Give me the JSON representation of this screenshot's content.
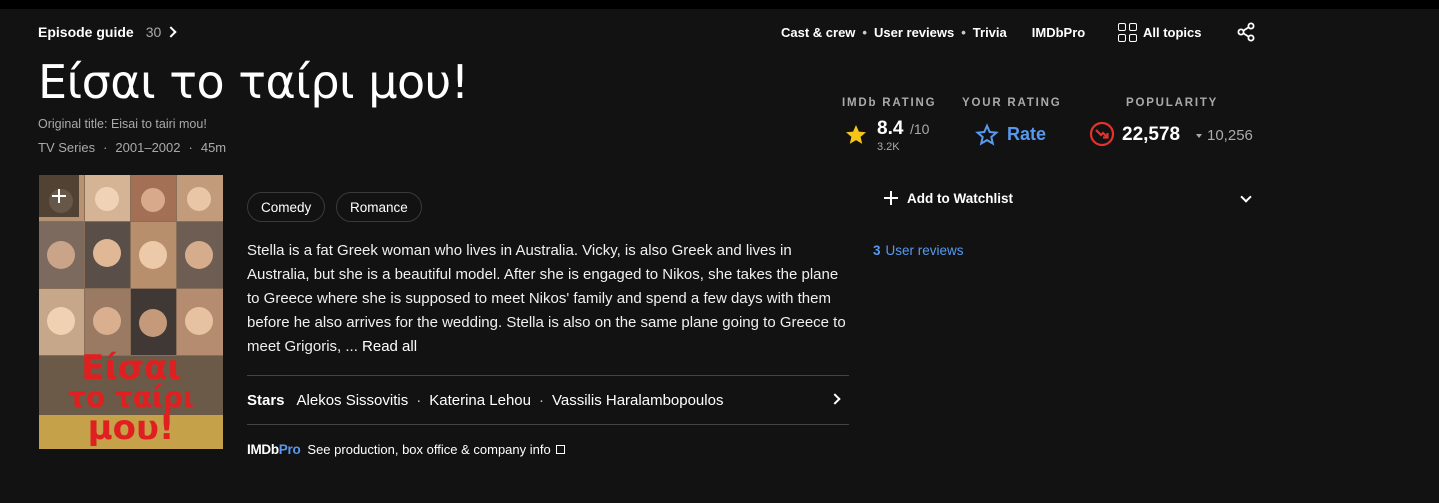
{
  "top": {
    "episode_guide_label": "Episode guide",
    "episode_count": "30",
    "links": [
      "Cast & crew",
      "User reviews",
      "Trivia"
    ],
    "imdbpro_label": "IMDbPro",
    "all_topics_label": "All topics"
  },
  "title": {
    "main": "Είσαι το ταίρι μου!",
    "original": "Original title: Eisai to tairi mou!",
    "type": "TV Series",
    "years": "2001–2002",
    "runtime": "45m"
  },
  "ratings": {
    "imdb_label": "IMDb RATING",
    "imdb_value": "8.4",
    "imdb_scale": "/10",
    "imdb_count": "3.2K",
    "your_label": "YOUR RATING",
    "rate_label": "Rate",
    "popularity_label": "POPULARITY",
    "popularity_value": "22,578",
    "popularity_delta": "10,256",
    "star_color": "#f5c518",
    "accent_color": "#5799ef",
    "popularity_icon_color": "#e5322d"
  },
  "genres": [
    "Comedy",
    "Romance"
  ],
  "plot": {
    "text": "Stella is a fat Greek woman who lives in Australia. Vicky, is also Greek and lives in Australia, but she is a beautiful model. After she is engaged to Nikos, she takes the plane to Greece where she is supposed to meet Nikos' family and spend a few days with them before he also arrives for the wedding. Stella is also on the same plane going to Greece to meet Grigoris, ...",
    "read_all": "Read all"
  },
  "stars": {
    "label": "Stars",
    "names": [
      "Alekos Sissovitis",
      "Katerina Lehou",
      "Vassilis Haralambopoulos"
    ]
  },
  "pro": {
    "logo_imdb": "IMDb",
    "logo_pro": "Pro",
    "text": "See production, box office & company info"
  },
  "sidebar": {
    "watchlist_label": "Add to Watchlist",
    "reviews_count": "3",
    "reviews_label": "User reviews"
  },
  "poster": {
    "title_lines": [
      "Είσαι",
      "το ταίρι",
      "μου!"
    ]
  }
}
